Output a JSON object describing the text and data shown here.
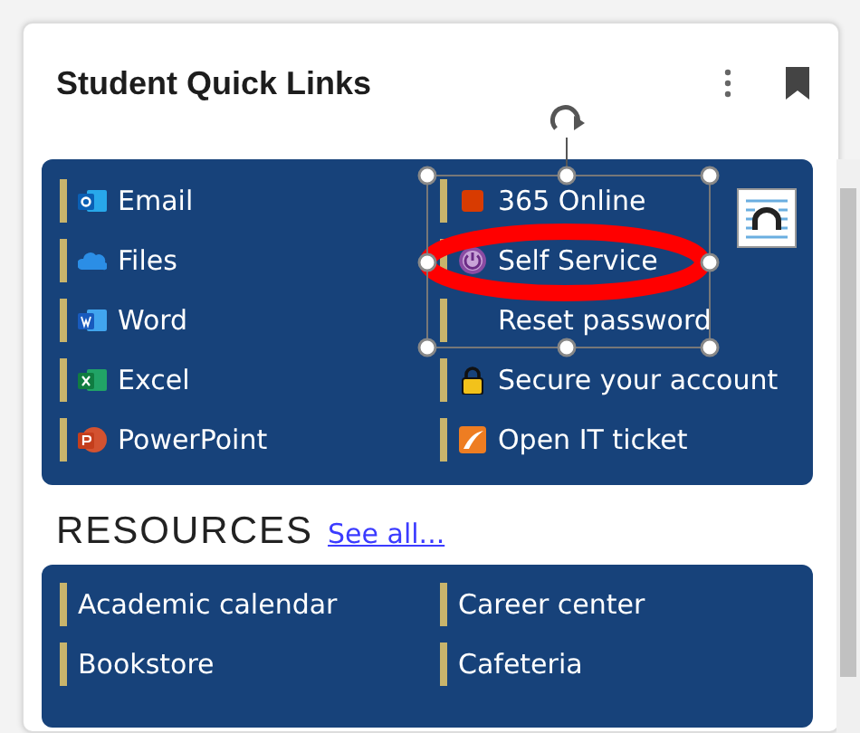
{
  "card": {
    "title": "Student Quick Links"
  },
  "quick_links": [
    {
      "label": "Email",
      "kind": "outlook"
    },
    {
      "label": "365 Online",
      "kind": "office"
    },
    {
      "label": "Files",
      "kind": "cloud"
    },
    {
      "label": "Self Service",
      "kind": "selfservice"
    },
    {
      "label": "Word",
      "kind": "word"
    },
    {
      "label": "Reset password",
      "kind": "none"
    },
    {
      "label": "Excel",
      "kind": "excel"
    },
    {
      "label": "Secure your account",
      "kind": "lock"
    },
    {
      "label": "PowerPoint",
      "kind": "powerpoint"
    },
    {
      "label": "Open IT ticket",
      "kind": "ticket"
    }
  ],
  "resources": {
    "heading": "RESOURCES",
    "see_all": "See all...",
    "items": [
      {
        "label": "Academic calendar"
      },
      {
        "label": "Career center"
      },
      {
        "label": "Bookstore"
      },
      {
        "label": "Cafeteria"
      }
    ]
  }
}
